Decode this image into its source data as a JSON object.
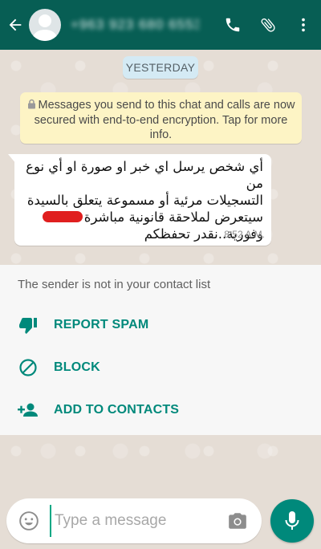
{
  "header": {
    "contact_name": "+963 923 680 6553",
    "back_icon": "arrow-left-icon",
    "call_icon": "phone-icon",
    "attach_icon": "paperclip-icon",
    "menu_icon": "more-vert-icon"
  },
  "chat": {
    "date_label": "YESTERDAY",
    "encryption_notice": "Messages you send to this chat and calls are now secured with end-to-end encryption. Tap for more info.",
    "message": {
      "line1": "أي شخص يرسل اي خبر او صورة او أي نوع من",
      "line2": "التسجيلات مرئية أو مسموعة يتعلق بالسيدة",
      "line3": "سيتعرض لملاحقة قانونية مباشرة",
      "line4": "وفورية..نقدر تحفظكم",
      "time": "8:52 A.M."
    }
  },
  "unknown_sender": {
    "notice": "The sender is not in your contact list",
    "actions": [
      {
        "label": "REPORT SPAM",
        "icon": "thumbs-down-icon"
      },
      {
        "label": "BLOCK",
        "icon": "block-icon"
      },
      {
        "label": "ADD TO CONTACTS",
        "icon": "add-person-icon"
      }
    ]
  },
  "composer": {
    "placeholder": "Type a message",
    "emoji_icon": "emoji-icon",
    "camera_icon": "camera-icon",
    "mic_icon": "mic-icon"
  },
  "colors": {
    "header": "#075e54",
    "accent": "#00897b",
    "chat_background": "#e5ddd5",
    "encryption_notice_bg": "#fdf4c5",
    "date_pill_bg": "#d4eaf4",
    "redaction": "#e01f1f"
  }
}
